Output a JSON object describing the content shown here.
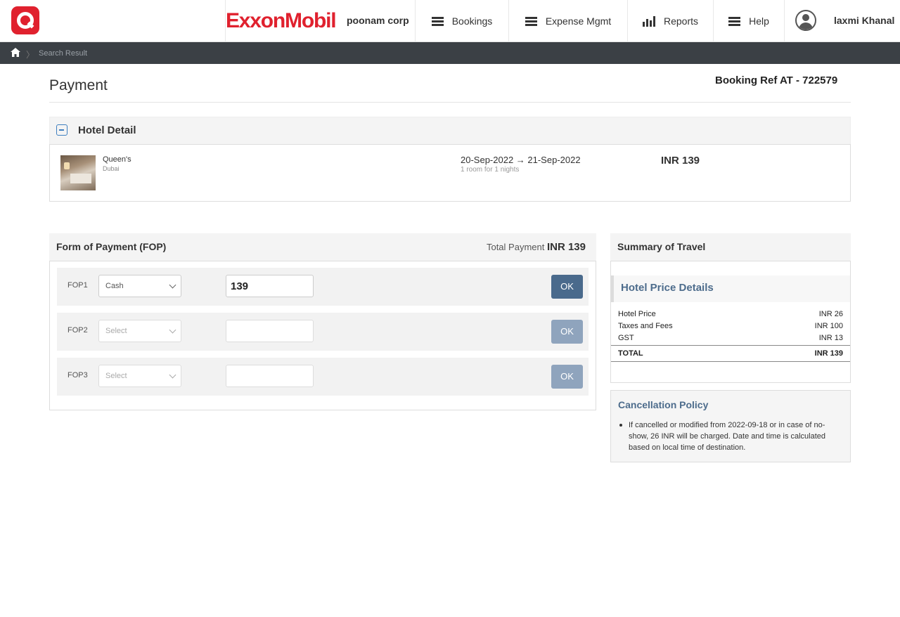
{
  "header": {
    "brand": "ExxonMobil",
    "company": "poonam corp",
    "nav": [
      {
        "label": "Bookings",
        "icon": "menu-icon"
      },
      {
        "label": "Expense Mgmt",
        "icon": "menu-icon"
      },
      {
        "label": "Reports",
        "icon": "bar-chart-icon"
      },
      {
        "label": "Help",
        "icon": "menu-icon"
      }
    ],
    "user_name": "laxmi Khanal"
  },
  "breadcrumb": {
    "home_icon": "home-icon",
    "current": "Search Result"
  },
  "page": {
    "title": "Payment",
    "booking_ref": "Booking Ref AT - 722579"
  },
  "hotel_detail": {
    "heading": "Hotel Detail",
    "hotel_name": "Queen's",
    "city": "Dubai",
    "dates": "20-Sep-2022 → 21-Sep-2022",
    "room_info": "1 room for 1 nights",
    "price": "INR 139"
  },
  "fop": {
    "heading": "Form of Payment (FOP)",
    "total_label": "Total Payment",
    "total_value": "INR 139",
    "rows": [
      {
        "label": "FOP1",
        "select": "Cash",
        "amount": "139",
        "ok": "OK",
        "enabled": true
      },
      {
        "label": "FOP2",
        "select": "Select",
        "amount": "",
        "ok": "OK",
        "enabled": false
      },
      {
        "label": "FOP3",
        "select": "Select",
        "amount": "",
        "ok": "OK",
        "enabled": false
      }
    ]
  },
  "summary": {
    "heading": "Summary of Travel",
    "price_details_heading": "Hotel Price Details",
    "lines": [
      {
        "label": "Hotel Price",
        "value": "INR 26"
      },
      {
        "label": "Taxes and Fees",
        "value": "INR 100"
      },
      {
        "label": "GST",
        "value": "INR 13"
      }
    ],
    "total_label": "TOTAL",
    "total_value": "INR 139"
  },
  "cancellation": {
    "heading": "Cancellation Policy",
    "text": "If cancelled or modified from 2022-09-18 or in case of no-show, 26 INR will be charged. Date and time is calculated based on local time of destination."
  }
}
